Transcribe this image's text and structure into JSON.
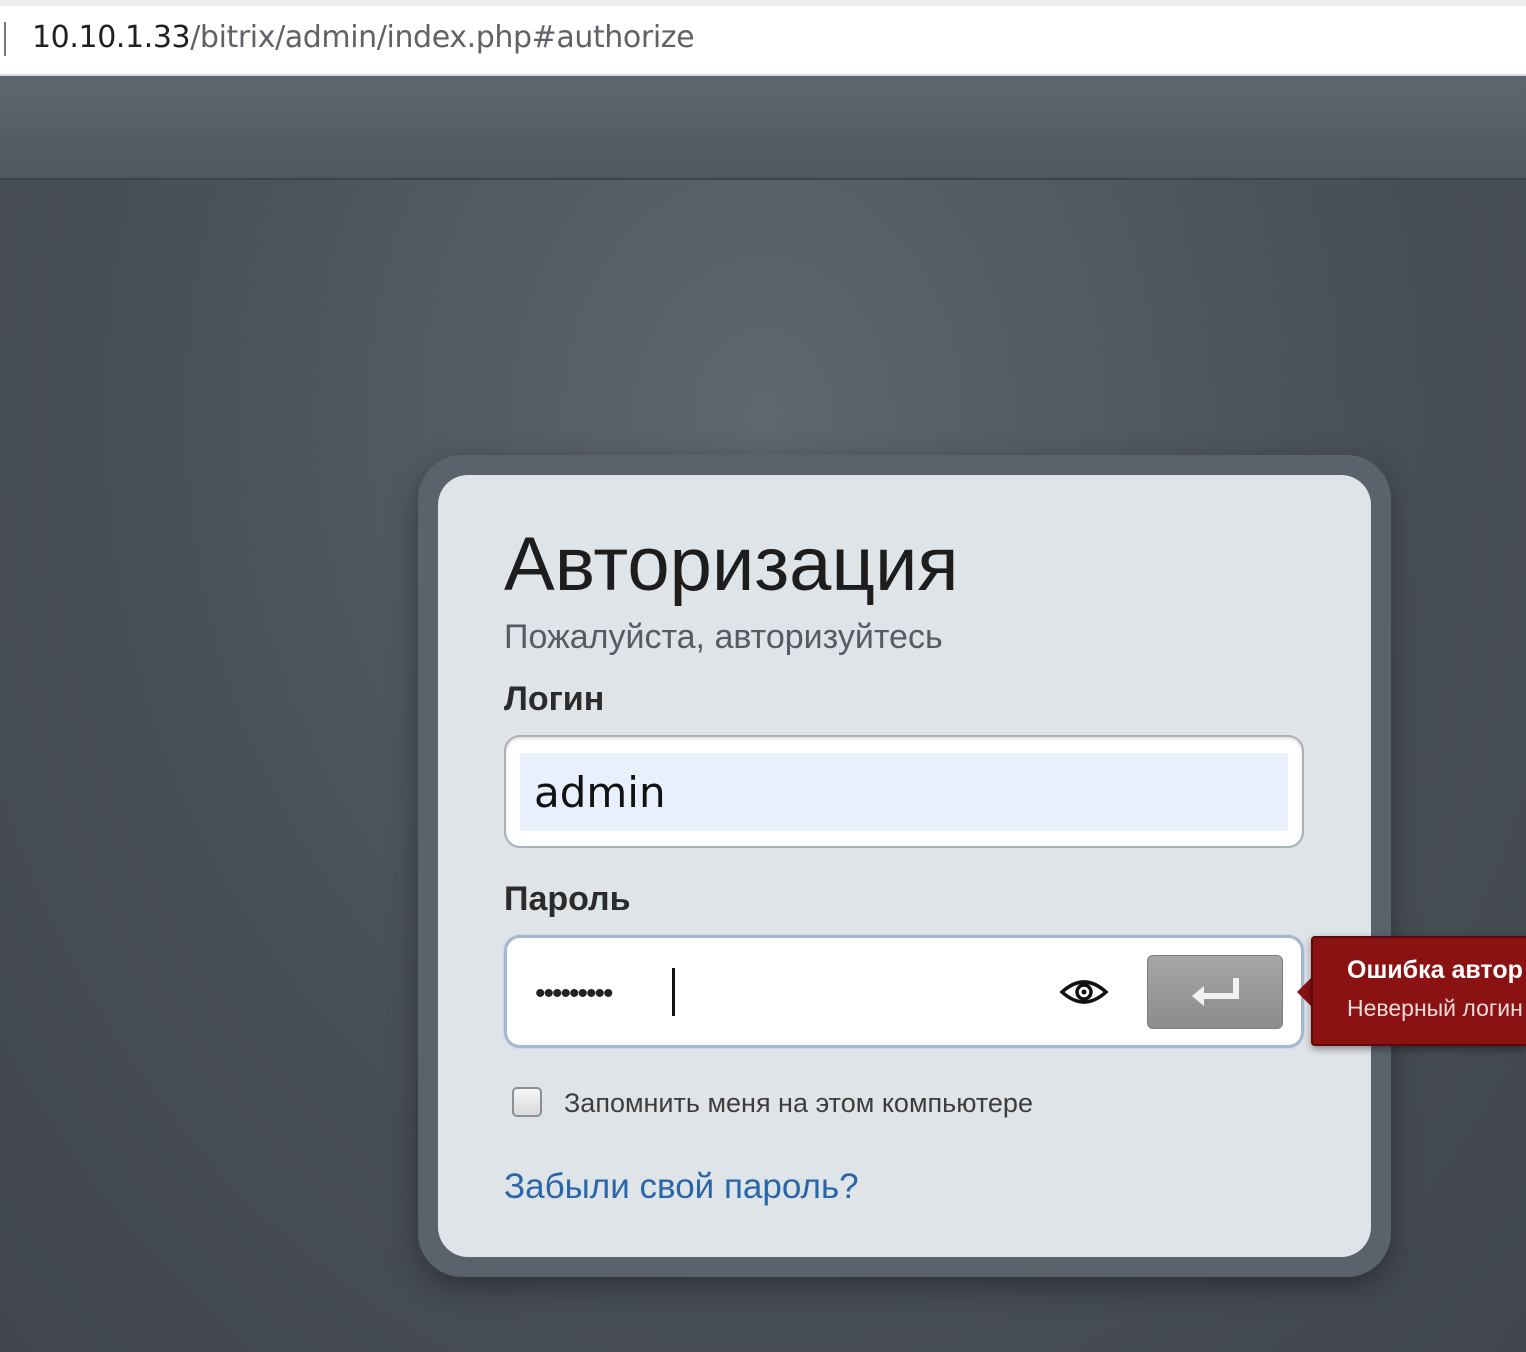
{
  "browser": {
    "url_host": "10.10.1.33",
    "url_path": "/bitrix/admin/index.php#authorize"
  },
  "auth": {
    "title": "Авторизация",
    "subtitle": "Пожалуйста, авторизуйтесь",
    "login_label": "Логин",
    "login_value": "admin",
    "password_label": "Пароль",
    "password_masked": "•••••••••",
    "remember_label": "Запомнить меня на этом компьютере",
    "remember_checked": false,
    "forgot_link": "Забыли свой пароль?",
    "show_password_icon": "eye-icon",
    "submit_icon": "enter-arrow-icon"
  },
  "error": {
    "title": "Ошибка автор",
    "message": "Неверный логин"
  },
  "colors": {
    "error_background": "#8b1212",
    "link": "#2766a8",
    "autofill_background": "#e8f0fe"
  }
}
